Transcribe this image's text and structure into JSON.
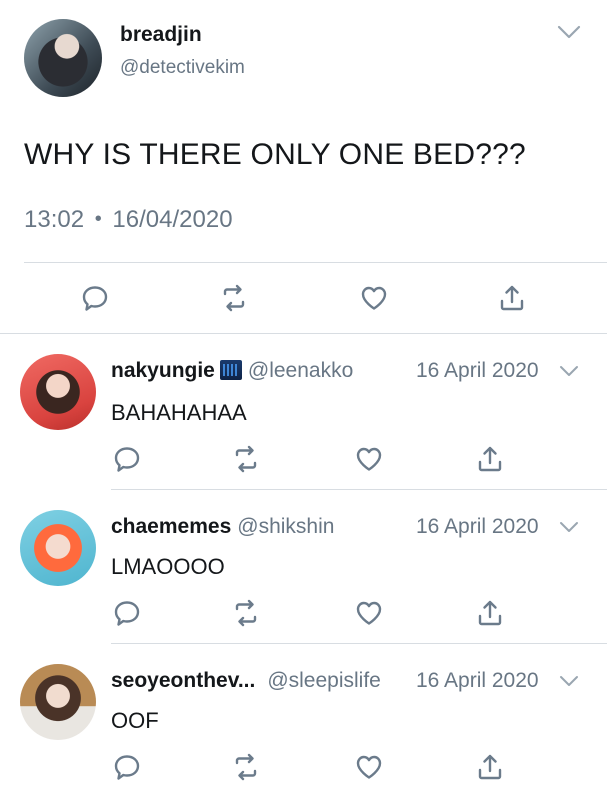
{
  "main_tweet": {
    "author_name": "breadjin",
    "author_handle": "@detectivekim",
    "text": "WHY IS THERE ONLY ONE BED???",
    "time": "13:02",
    "separator": "•",
    "date": "16/04/2020",
    "icons": [
      "chevron-down-icon",
      "reply-icon",
      "retweet-icon",
      "like-icon",
      "share-icon"
    ]
  },
  "replies": [
    {
      "author_name": "nakyungie",
      "author_handle": "@leenakko",
      "date": "16 April 2020",
      "text": "BAHAHAHAA",
      "has_badge": true
    },
    {
      "author_name": "chaememes",
      "author_handle": "@shikshin",
      "date": "16 April 2020",
      "text": "LMAOOOO",
      "has_badge": false
    },
    {
      "author_name": "seoyeonthev...",
      "author_handle": "@sleepislife",
      "date": "16 April 2020",
      "text": "OOF",
      "has_badge": false
    }
  ],
  "colors": {
    "text": "#14171a",
    "secondary": "#687684",
    "divider": "#d8dde2",
    "icon": "#6b7b8b"
  }
}
